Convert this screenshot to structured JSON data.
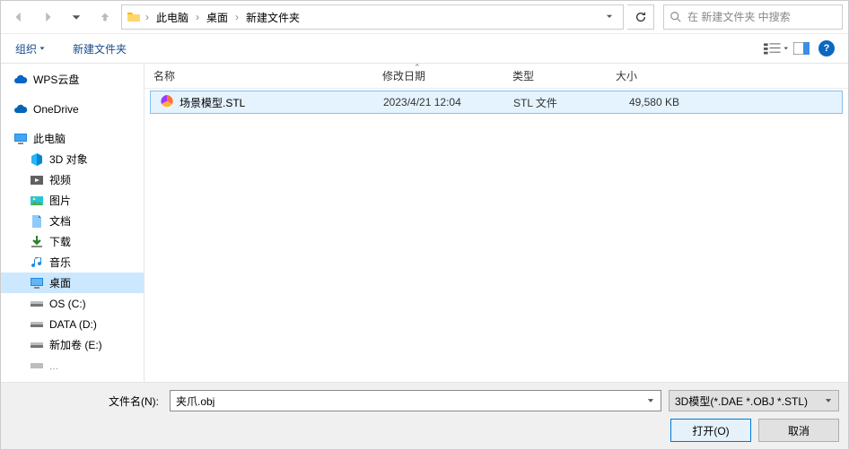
{
  "breadcrumbs": [
    "此电脑",
    "桌面",
    "新建文件夹"
  ],
  "search": {
    "placeholder": "在 新建文件夹 中搜索"
  },
  "toolbar": {
    "organize": "组织",
    "new_folder": "新建文件夹"
  },
  "columns": {
    "name": "名称",
    "date": "修改日期",
    "type": "类型",
    "size": "大小"
  },
  "tree": {
    "wps": "WPS云盘",
    "onedrive": "OneDrive",
    "this_pc": "此电脑",
    "objects3d": "3D 对象",
    "videos": "视频",
    "pictures": "图片",
    "documents": "文档",
    "downloads": "下载",
    "music": "音乐",
    "desktop": "桌面",
    "os_c": "OS (C:)",
    "data_d": "DATA (D:)",
    "vol_e": "新加卷 (E:)"
  },
  "files": [
    {
      "name": "场景模型.STL",
      "date": "2023/4/21 12:04",
      "type": "STL 文件",
      "size": "49,580 KB"
    }
  ],
  "footer": {
    "filename_label": "文件名(N):",
    "filename_value": "夹爪.obj",
    "filter": "3D模型(*.DAE *.OBJ *.STL)",
    "open": "打开(O)",
    "cancel": "取消"
  }
}
